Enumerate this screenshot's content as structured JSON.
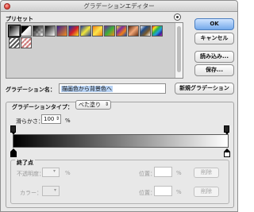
{
  "window": {
    "title": "グラデーションエディター"
  },
  "presets": {
    "label": "プリセット",
    "swatch_names": [
      "black-white",
      "fg-transparent",
      "black-transparent",
      "black-white-2",
      "violet-orange",
      "blue-red-yellow",
      "blue-yellow-blue",
      "orange-yellow-orange",
      "violet-green-orange",
      "yellow-violet-orange-blue",
      "copper",
      "chrome",
      "spectrum",
      "transparent-stripes",
      "transparent-rainbow"
    ]
  },
  "buttons": {
    "ok": "OK",
    "cancel": "キャンセル",
    "load": "読み込み...",
    "save": "保存...",
    "new_gradient": "新規グラデーション"
  },
  "name": {
    "label": "グラデーション名：",
    "value": "描画色から背景色へ"
  },
  "gradient_type": {
    "label": "グラデーションタイプ：",
    "selected": "べた塗り"
  },
  "smoothness": {
    "label": "滑らかさ：",
    "value": "100",
    "unit": "%"
  },
  "gradient": {
    "start_color": "#000000",
    "end_color": "#ffffff"
  },
  "stops": {
    "title": "終了点",
    "opacity_label": "不透明度：",
    "opacity_unit": "%",
    "position_label": "位置：",
    "position_unit": "%",
    "delete_label": "削除",
    "color_label": "カラー：",
    "position_label_2": "位置：",
    "position_unit_2": "%",
    "delete_label_2": "削除"
  },
  "colors": {
    "ok_button": "#74a9ea",
    "highlight": "#b8d3f5"
  }
}
